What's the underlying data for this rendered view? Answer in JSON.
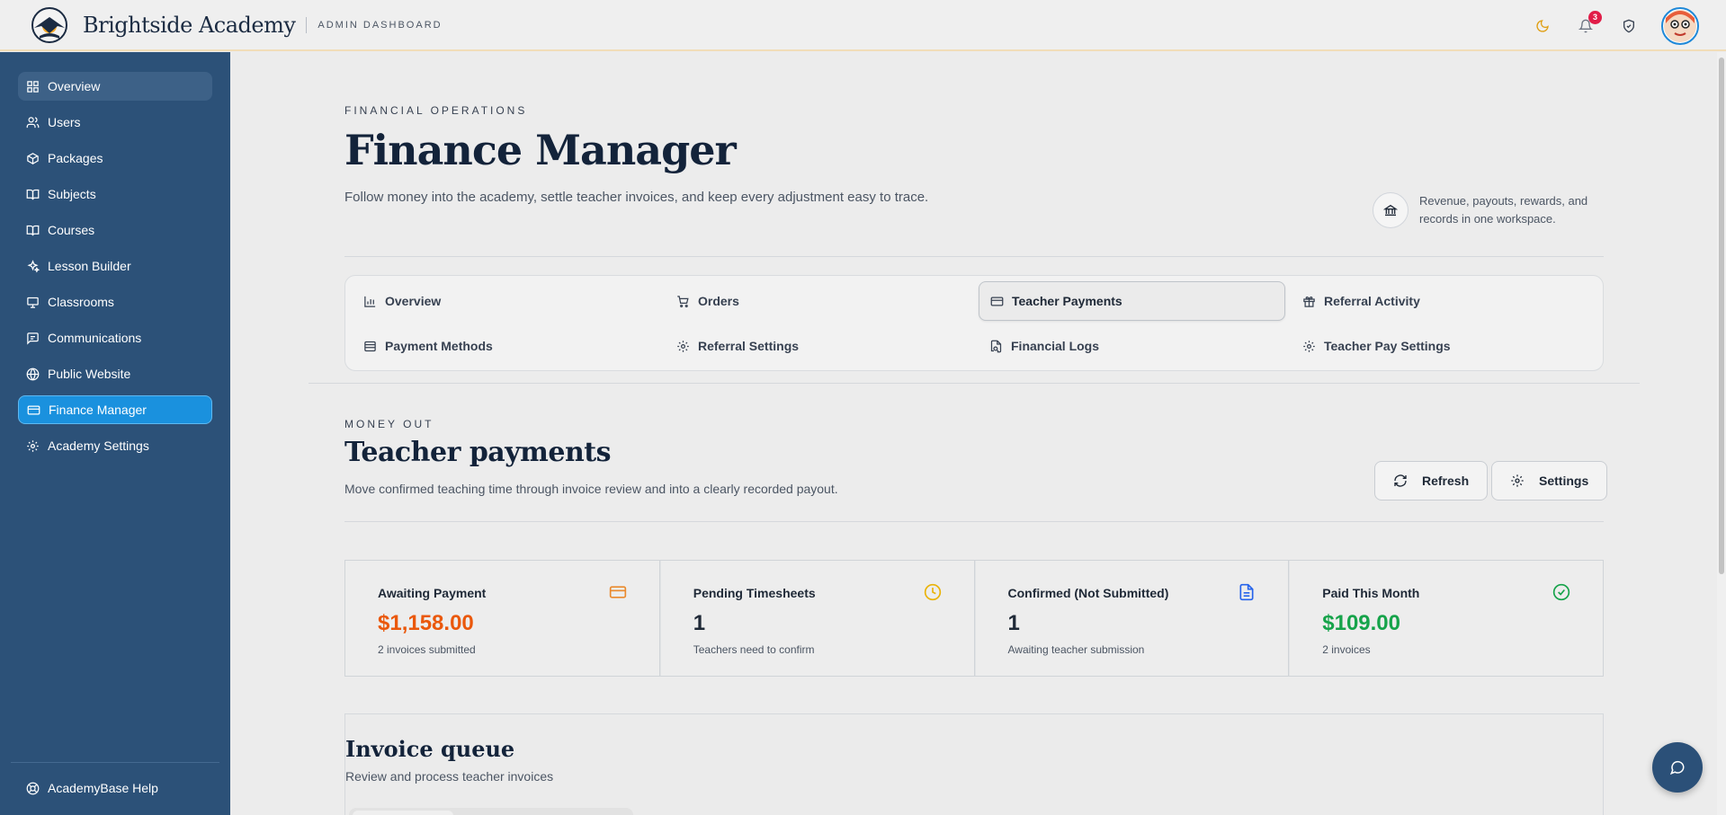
{
  "header": {
    "brand": "Brightside Academy",
    "subtitle": "ADMIN DASHBOARD",
    "notification_count": "3",
    "icons": [
      "moon-icon",
      "bell-icon",
      "shield-icon"
    ]
  },
  "sidebar": {
    "items": [
      {
        "label": "Overview",
        "icon": "grid-icon"
      },
      {
        "label": "Users",
        "icon": "users-icon"
      },
      {
        "label": "Packages",
        "icon": "package-icon"
      },
      {
        "label": "Subjects",
        "icon": "book-icon"
      },
      {
        "label": "Courses",
        "icon": "book-open-icon"
      },
      {
        "label": "Lesson Builder",
        "icon": "sparkles-icon"
      },
      {
        "label": "Classrooms",
        "icon": "presentation-icon"
      },
      {
        "label": "Communications",
        "icon": "message-icon"
      },
      {
        "label": "Public Website",
        "icon": "globe-icon"
      },
      {
        "label": "Finance Manager",
        "icon": "credit-card-icon"
      },
      {
        "label": "Academy Settings",
        "icon": "gear-icon"
      }
    ],
    "active": "Finance Manager",
    "help": "AcademyBase Help"
  },
  "page": {
    "eyebrow": "FINANCIAL OPERATIONS",
    "title": "Finance Manager",
    "lead": "Follow money into the academy, settle teacher invoices, and keep every adjustment easy to trace.",
    "side_note": "Revenue, payouts, rewards, and records in one workspace."
  },
  "tabs": [
    {
      "label": "Overview",
      "icon": "bar-chart-icon"
    },
    {
      "label": "Orders",
      "icon": "cart-icon"
    },
    {
      "label": "Teacher Payments",
      "icon": "credit-card-icon"
    },
    {
      "label": "Referral Activity",
      "icon": "gift-icon"
    },
    {
      "label": "Payment Methods",
      "icon": "wallet-icon"
    },
    {
      "label": "Referral Settings",
      "icon": "gear-icon"
    },
    {
      "label": "Financial Logs",
      "icon": "file-search-icon"
    },
    {
      "label": "Teacher Pay Settings",
      "icon": "gear-icon"
    }
  ],
  "active_tab": "Teacher Payments",
  "section": {
    "eyebrow": "MONEY OUT",
    "title": "Teacher payments",
    "description": "Move confirmed teaching time through invoice review and into a clearly recorded payout.",
    "refresh_label": "Refresh",
    "settings_label": "Settings"
  },
  "stats": [
    {
      "label": "Awaiting Payment",
      "value": "$1,158.00",
      "sub": "2 invoices submitted",
      "color": "#ea580c",
      "icon": "credit-card-icon"
    },
    {
      "label": "Pending Timesheets",
      "value": "1",
      "sub": "Teachers need to confirm",
      "color": "#1f2937",
      "icon": "clock-icon"
    },
    {
      "label": "Confirmed (Not Submitted)",
      "value": "1",
      "sub": "Awaiting teacher submission",
      "color": "#1f2937",
      "icon": "document-icon"
    },
    {
      "label": "Paid This Month",
      "value": "$109.00",
      "sub": "2 invoices",
      "color": "#16a34a",
      "icon": "check-circle-icon"
    }
  ],
  "queue": {
    "title": "Invoice queue",
    "subtitle": "Review and process teacher invoices"
  },
  "colors": {
    "sidebar": "#2c5178",
    "active_nav": "#1a91de",
    "accent_orange": "#ea580c",
    "accent_green": "#16a34a",
    "accent_blue": "#2563eb",
    "accent_yellow": "#eab308"
  }
}
